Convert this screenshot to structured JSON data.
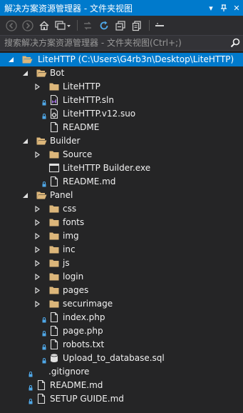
{
  "window": {
    "title": "解决方案资源管理器 - 文件夹视图",
    "dropdown_glyph": "▾",
    "pin_glyph": "⊣",
    "close_glyph": "✕"
  },
  "toolbar": {
    "back_icon": "arrow-left-icon",
    "forward_icon": "arrow-right-icon",
    "home_icon": "home-icon",
    "switch_views_icon": "switch-views-icon",
    "pending_changes_icon": "pending-changes-icon",
    "refresh_icon": "refresh-icon",
    "collapse_all_icon": "collapse-all-icon",
    "show_all_icon": "show-all-files-icon",
    "properties_icon": "properties-icon"
  },
  "search": {
    "placeholder": "搜索解决方案资源管理器 - 文件夹视图(Ctrl+;)"
  },
  "tree": [
    {
      "label": "LiteHTTP (C:\\Users\\G4rb3n\\Desktop\\LiteHTTP)",
      "level": 0,
      "kind": "root",
      "expanded": true,
      "selected": true,
      "lock": false
    },
    {
      "label": "Bot",
      "level": 1,
      "kind": "folder",
      "expanded": true,
      "lock": false
    },
    {
      "label": "LiteHTTP",
      "level": 2,
      "kind": "folder",
      "expanded": false,
      "lock": false
    },
    {
      "label": "LiteHTTP.sln",
      "level": 2,
      "kind": "sln",
      "lock": true
    },
    {
      "label": "LiteHTTP.v12.suo",
      "level": 2,
      "kind": "suo",
      "lock": true
    },
    {
      "label": "README",
      "level": 2,
      "kind": "file",
      "lock": false
    },
    {
      "label": "Builder",
      "level": 1,
      "kind": "folder",
      "expanded": true,
      "lock": false
    },
    {
      "label": "Source",
      "level": 2,
      "kind": "folder",
      "expanded": false,
      "lock": false
    },
    {
      "label": "LiteHTTP Builder.exe",
      "level": 2,
      "kind": "exe",
      "lock": false
    },
    {
      "label": "README.md",
      "level": 2,
      "kind": "file",
      "lock": true
    },
    {
      "label": "Panel",
      "level": 1,
      "kind": "folder",
      "expanded": true,
      "lock": false
    },
    {
      "label": "css",
      "level": 2,
      "kind": "folder",
      "expanded": false,
      "lock": false
    },
    {
      "label": "fonts",
      "level": 2,
      "kind": "folder",
      "expanded": false,
      "lock": false
    },
    {
      "label": "img",
      "level": 2,
      "kind": "folder",
      "expanded": false,
      "lock": false
    },
    {
      "label": "inc",
      "level": 2,
      "kind": "folder",
      "expanded": false,
      "lock": false
    },
    {
      "label": "js",
      "level": 2,
      "kind": "folder",
      "expanded": false,
      "lock": false
    },
    {
      "label": "login",
      "level": 2,
      "kind": "folder",
      "expanded": false,
      "lock": false
    },
    {
      "label": "pages",
      "level": 2,
      "kind": "folder",
      "expanded": false,
      "lock": false
    },
    {
      "label": "securimage",
      "level": 2,
      "kind": "folder",
      "expanded": false,
      "lock": false
    },
    {
      "label": "index.php",
      "level": 2,
      "kind": "file",
      "lock": true
    },
    {
      "label": "page.php",
      "level": 2,
      "kind": "file",
      "lock": true
    },
    {
      "label": "robots.txt",
      "level": 2,
      "kind": "file",
      "lock": true
    },
    {
      "label": "Upload_to_database.sql",
      "level": 2,
      "kind": "sql",
      "lock": true
    },
    {
      "label": ".gitignore",
      "level": 1,
      "kind": "none",
      "lock": true
    },
    {
      "label": "README.md",
      "level": 1,
      "kind": "file",
      "lock": true
    },
    {
      "label": "SETUP GUIDE.md",
      "level": 1,
      "kind": "file",
      "lock": true
    }
  ],
  "colors": {
    "accent": "#007acc",
    "background": "#252526",
    "folder": "#dcb67a",
    "text": "#f1f1f1"
  }
}
